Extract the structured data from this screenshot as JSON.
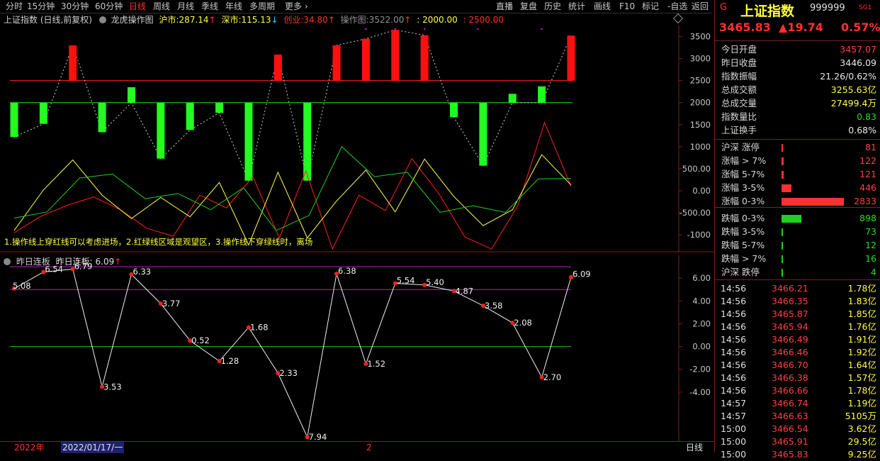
{
  "toolbar": {
    "left": [
      "分时",
      "15分钟",
      "30分钟",
      "60分钟",
      "日线",
      "周线",
      "月线",
      "季线",
      "年线",
      "多周期",
      "更多"
    ],
    "active_index": 4,
    "right": [
      "直播",
      "复盘",
      "历史",
      "统计",
      "画线",
      "F10",
      "标记",
      "-自选",
      "返回"
    ]
  },
  "main_header": {
    "title": "上证指数 (日线,前复权)",
    "indicator": "龙虎操作图",
    "hs_label": "沪市:",
    "hs_value": "287.14",
    "sz_label": "深市:",
    "sz_value": "115.13",
    "cy_label": "创业:",
    "cy_value": "34.80",
    "op_label": "操作图:",
    "op_value": "3522.00",
    "v2": ": 2000.00",
    "v3": ": 2500.00"
  },
  "note": "1.操作线上穿红线可以考虑进场，2.红绿线区域是观望区，3.操作线下穿绿线时，离场",
  "sub_header": {
    "title": "昨日连板",
    "label": "昨日连板:",
    "value": "6.09"
  },
  "bottom_bar": {
    "year": "2022年",
    "date": "2022/01/17/一",
    "mark": "2",
    "period": "日线"
  },
  "chart_data": [
    {
      "type": "bar",
      "name": "龙虎操作图",
      "ylim": [
        -1400,
        3750
      ],
      "yticks": [
        3500,
        3000,
        2500,
        2000,
        1500,
        1000,
        500,
        0,
        -500,
        -1000
      ],
      "ytick_labels": [
        "3500",
        "3000",
        "2500",
        "2000",
        "1500",
        "1000",
        "500.00",
        "0.00",
        "-500.00",
        "-1000"
      ],
      "baseline_red": 2500,
      "baseline_green": 2000,
      "bars": [
        {
          "top": 2000,
          "bottom": 1220,
          "color": "green"
        },
        {
          "top": 2000,
          "bottom": 1520,
          "color": "green"
        },
        {
          "top": 3300,
          "bottom": 2500,
          "color": "red"
        },
        {
          "top": 2000,
          "bottom": 1330,
          "color": "green"
        },
        {
          "top": 2350,
          "bottom": 2000,
          "color": "green"
        },
        {
          "top": 2000,
          "bottom": 730,
          "color": "green"
        },
        {
          "top": 2000,
          "bottom": 1380,
          "color": "green"
        },
        {
          "top": 2000,
          "bottom": 1770,
          "color": "green"
        },
        {
          "top": 2000,
          "bottom": 230,
          "color": "green"
        },
        {
          "top": 3090,
          "bottom": 2500,
          "color": "red"
        },
        {
          "top": 2000,
          "bottom": 230,
          "color": "green"
        },
        {
          "top": 3300,
          "bottom": 2500,
          "color": "red"
        },
        {
          "top": 3450,
          "bottom": 2500,
          "color": "red"
        },
        {
          "top": 3650,
          "bottom": 2500,
          "color": "red"
        },
        {
          "top": 3530,
          "bottom": 2500,
          "color": "red"
        },
        {
          "top": 2000,
          "bottom": 1670,
          "color": "green"
        },
        {
          "top": 2000,
          "bottom": 570,
          "color": "green"
        },
        {
          "top": 2200,
          "bottom": 2000,
          "color": "green"
        },
        {
          "top": 2370,
          "bottom": 2000,
          "color": "green"
        },
        {
          "top": 3522,
          "bottom": 2500,
          "color": "red"
        }
      ],
      "series": [
        {
          "name": "红线",
          "color": "#ff2020",
          "values": [
            -950,
            -580,
            -330,
            -140,
            -430,
            -850,
            -1030,
            -100,
            -390,
            320,
            -1070,
            450,
            -1320,
            -100,
            -450,
            730,
            -50,
            -1050,
            -1320,
            -330,
            1550,
            100
          ]
        },
        {
          "name": "黄线",
          "color": "#ffff40",
          "values": [
            -900,
            20,
            700,
            -100,
            -630,
            -150,
            -590,
            190,
            -1230,
            420,
            -1070,
            -230,
            470,
            -480,
            720,
            -130,
            -790,
            -430,
            820,
            130
          ]
        },
        {
          "name": "绿线",
          "color": "#20d020",
          "values": [
            -620,
            -480,
            290,
            380,
            -180,
            -60,
            -430,
            70,
            -900,
            -560,
            1000,
            320,
            420,
            -490,
            -340,
            -490,
            270,
            280
          ]
        }
      ]
    },
    {
      "type": "line",
      "name": "昨日连板",
      "ylim": [
        -8.3,
        8.0
      ],
      "yticks": [
        6,
        4,
        2,
        0,
        -2,
        -4
      ],
      "ytick_labels": [
        "6.00",
        "4.00",
        "2.00",
        "0.00",
        "-2.00",
        "-4.00"
      ],
      "ref_lines": [
        7.0,
        5.0,
        0.0
      ],
      "values": [
        5.08,
        6.54,
        6.79,
        -3.53,
        6.33,
        3.77,
        0.52,
        -1.28,
        1.68,
        -2.33,
        -7.94,
        6.38,
        -1.52,
        5.54,
        5.4,
        4.87,
        3.58,
        2.08,
        -2.7,
        6.09
      ],
      "labels": [
        "5.08",
        "6.54",
        "6.79",
        "3.53",
        "6.33",
        "3.77",
        "0.52",
        "1.28",
        "1.68",
        "2.33",
        "7.94",
        "6.38",
        "1.52",
        "5.54",
        "5.40",
        "4.87",
        "3.58",
        "2.08",
        "2.70",
        "6.09"
      ]
    }
  ],
  "quote": {
    "flag": "G",
    "name": "上证指数",
    "code": "999999",
    "tag": "SG1",
    "price": "3465.83",
    "change": "▲19.74",
    "pct": "0.57%"
  },
  "stats": [
    {
      "label": "今日开盘",
      "value": "3457.07",
      "color": "red"
    },
    {
      "label": "昨日收盘",
      "value": "3446.09",
      "color": "white"
    },
    {
      "label": "指数振幅",
      "value": "21.26/0.62%",
      "color": "white"
    },
    {
      "label": "总成交额",
      "value": "3255.63亿",
      "color": "yellow"
    },
    {
      "label": "总成交量",
      "value": "27499.4万",
      "color": "yellow"
    },
    {
      "label": "指数量比",
      "value": "0.83",
      "color": "green"
    },
    {
      "label": "上证换手",
      "value": "0.68%",
      "color": "white"
    }
  ],
  "breadth": [
    {
      "label": "沪深 涨停",
      "value": "81",
      "color": "red",
      "frac": 0.02
    },
    {
      "label": "涨幅 > 7%",
      "value": "122",
      "color": "red",
      "frac": 0.03
    },
    {
      "label": "涨幅 5-7%",
      "value": "121",
      "color": "red",
      "frac": 0.03
    },
    {
      "label": "涨幅 3-5%",
      "value": "446",
      "color": "red",
      "frac": 0.16
    },
    {
      "label": "涨幅 0-3%",
      "value": "2833",
      "color": "red",
      "frac": 1.0
    },
    {
      "label": "跌幅 0-3%",
      "value": "898",
      "color": "green",
      "frac": 0.32
    },
    {
      "label": "跌幅 3-5%",
      "value": "73",
      "color": "green",
      "frac": 0.02
    },
    {
      "label": "跌幅 5-7%",
      "value": "12",
      "color": "green",
      "frac": 0.01
    },
    {
      "label": "跌幅 > 7%",
      "value": "16",
      "color": "green",
      "frac": 0.01
    },
    {
      "label": "沪深 跌停",
      "value": "4",
      "color": "green",
      "frac": 0.005
    }
  ],
  "ticks": [
    {
      "t": "14:56",
      "p": "3466.21",
      "v": "1.78亿",
      "c": "yellow"
    },
    {
      "t": "14:56",
      "p": "3466.35",
      "v": "1.83亿",
      "c": "yellow"
    },
    {
      "t": "14:56",
      "p": "3465.87",
      "v": "1.85亿",
      "c": "yellow"
    },
    {
      "t": "14:56",
      "p": "3465.94",
      "v": "1.76亿",
      "c": "yellow"
    },
    {
      "t": "14:56",
      "p": "3466.49",
      "v": "1.91亿",
      "c": "yellow"
    },
    {
      "t": "14:56",
      "p": "3466.46",
      "v": "1.92亿",
      "c": "yellow"
    },
    {
      "t": "14:56",
      "p": "3466.70",
      "v": "1.64亿",
      "c": "yellow"
    },
    {
      "t": "14:56",
      "p": "3466.38",
      "v": "1.57亿",
      "c": "yellow"
    },
    {
      "t": "14:56",
      "p": "3466.66",
      "v": "1.78亿",
      "c": "yellow"
    },
    {
      "t": "14:57",
      "p": "3466.74",
      "v": "1.19亿",
      "c": "yellow"
    },
    {
      "t": "14:57",
      "p": "3466.63",
      "v": "5105万",
      "c": "yellow"
    },
    {
      "t": "15:00",
      "p": "3466.54",
      "v": "3.62亿",
      "c": "yellow"
    },
    {
      "t": "15:00",
      "p": "3465.91",
      "v": "29.5亿",
      "c": "yellow"
    },
    {
      "t": "15:00",
      "p": "3465.83",
      "v": "9.25亿",
      "c": "yellow"
    }
  ],
  "colors": {
    "up": "#ff3030",
    "down": "#20e020",
    "accent": "#ffff40",
    "magenta": "#c020c0"
  }
}
